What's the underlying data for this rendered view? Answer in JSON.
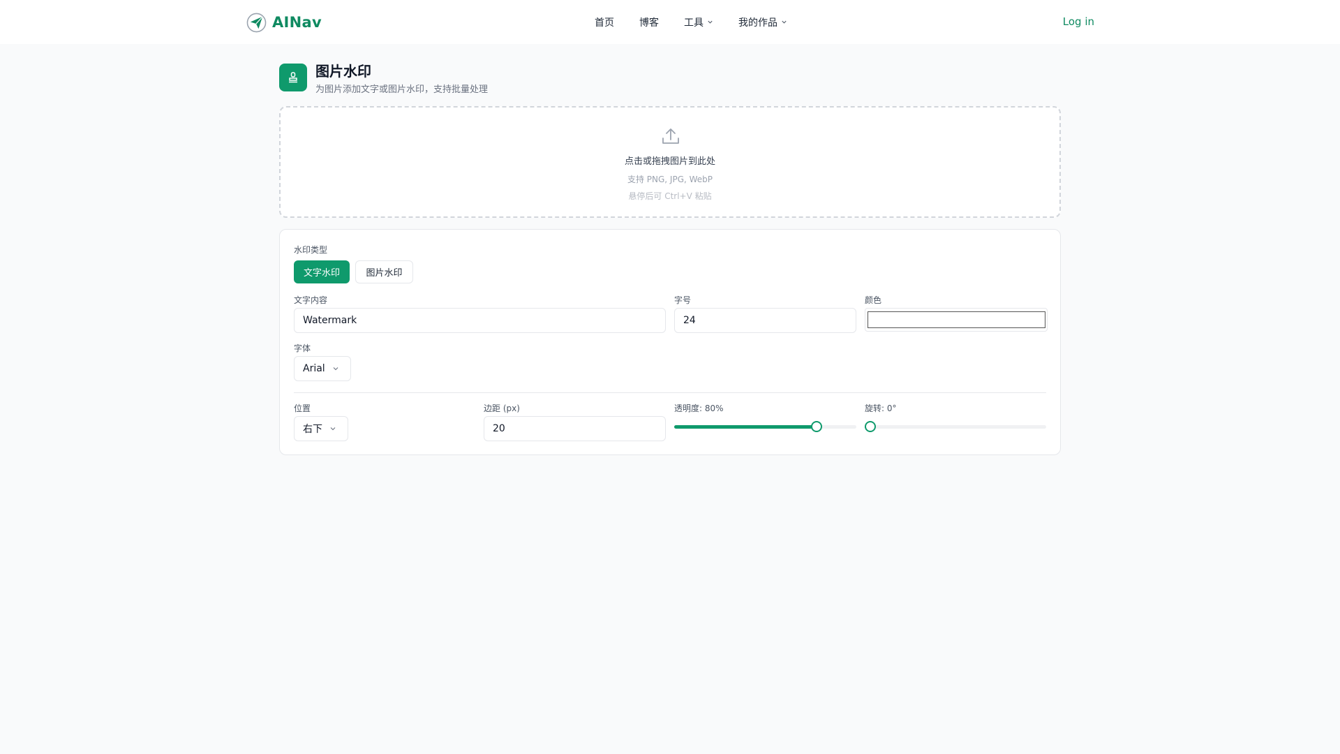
{
  "header": {
    "brand": "AINav",
    "nav": [
      {
        "label": "首页",
        "has_dropdown": false
      },
      {
        "label": "博客",
        "has_dropdown": false
      },
      {
        "label": "工具",
        "has_dropdown": true
      },
      {
        "label": "我的作品",
        "has_dropdown": true
      }
    ],
    "login_label": "Log in"
  },
  "page": {
    "title": "图片水印",
    "subtitle": "为图片添加文字或图片水印，支持批量处理",
    "icon": "stamp-icon"
  },
  "upload": {
    "icon": "upload-icon",
    "main": "点击或拖拽图片到此处",
    "formats": "支持 PNG, JPG, WebP",
    "hint": "悬停后可 Ctrl+V 粘贴"
  },
  "settings": {
    "type_label": "水印类型",
    "type_options": [
      "文字水印",
      "图片水印"
    ],
    "type_selected": "文字水印",
    "text_label": "文字内容",
    "text_value": "Watermark",
    "size_label": "字号",
    "size_value": "24",
    "color_label": "颜色",
    "color_value": "#ffffff",
    "font_label": "字体",
    "font_value": "Arial",
    "position_label": "位置",
    "position_value": "右下",
    "margin_label": "边距 (px)",
    "margin_value": "20",
    "opacity_label": "透明度: 80%",
    "opacity_value": 0.8,
    "rotation_label": "旋转: 0°",
    "rotation_value": 0
  },
  "colors": {
    "accent": "#0f9a6c",
    "brand_text": "#0f8a61"
  }
}
